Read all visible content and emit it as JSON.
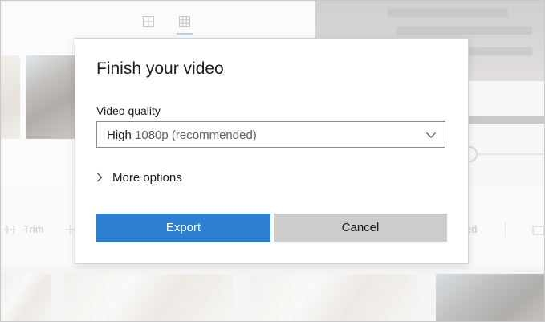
{
  "background_app": {
    "view_toggles": [
      {
        "icon": "grid-2x2-icon",
        "active": false
      },
      {
        "icon": "grid-3x3-icon",
        "active": true
      }
    ],
    "toolbar": {
      "trim_label": "Trim",
      "partial_right_label": "ed"
    }
  },
  "dialog": {
    "title": "Finish your video",
    "quality_label": "Video quality",
    "quality_select": {
      "value_quality": "High",
      "value_detail": " 1080p (recommended)",
      "icon": "chevron-down-icon"
    },
    "more_options": {
      "label": "More options",
      "icon": "chevron-right-icon"
    },
    "export_label": "Export",
    "cancel_label": "Cancel"
  },
  "colors": {
    "accent": "#2d7fd0",
    "cancel_bg": "#cccccc",
    "dialog_bg": "#ffffff"
  }
}
